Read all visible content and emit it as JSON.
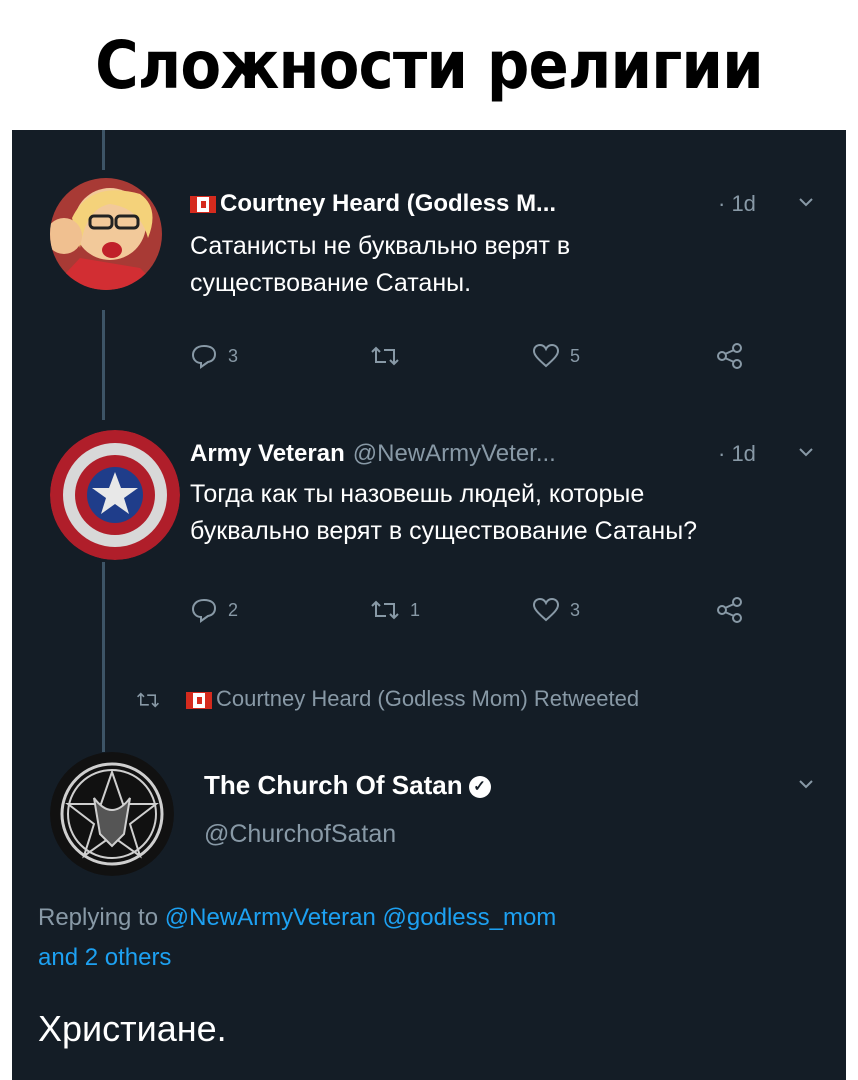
{
  "caption": "Сложности религии",
  "tweets": [
    {
      "name": "Courtney Heard (Godless M...",
      "handle": "",
      "time": "· 1d",
      "text_lines": [
        "Сатанисты не буквально верят в",
        "существование Сатаны."
      ],
      "replies": "3",
      "retweets": "",
      "likes": "5"
    },
    {
      "name": "Army Veteran",
      "handle": "@NewArmyVeter...",
      "time": "· 1d",
      "text_lines": [
        "Тогда как ты назовешь людей, которые",
        "буквально верят в существование Сатаны?"
      ],
      "replies": "2",
      "retweets": "1",
      "likes": "3"
    }
  ],
  "retweeted_by": "Courtney Heard (Godless Mom) Retweeted",
  "main_tweet": {
    "name": "The Church Of Satan",
    "handle": "@ChurchofSatan",
    "replying_prefix": "Replying to",
    "reply_handle_1": "@NewArmyVeteran",
    "reply_handle_2": "@godless_mom",
    "reply_suffix": "and 2 others",
    "text": "Христиане."
  },
  "icons": [
    "flag-canada-icon",
    "reply-icon",
    "retweet-icon",
    "like-icon",
    "share-icon",
    "chevron-down-icon",
    "verified-icon"
  ],
  "colors": {
    "background": "#141d26",
    "muted": "#8899a6",
    "link": "#1da1f2"
  }
}
